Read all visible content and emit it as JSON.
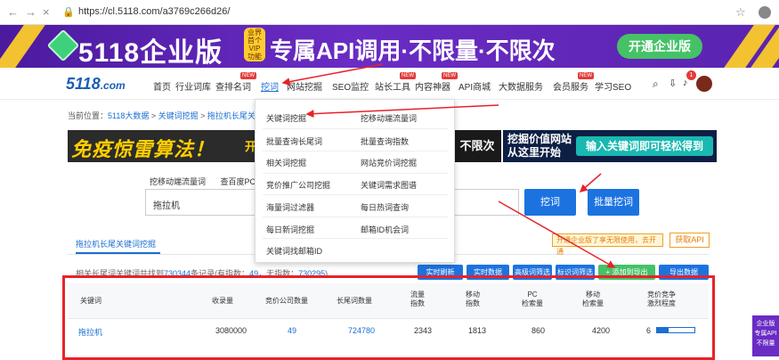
{
  "browser": {
    "url": "https://cl.5118.com/a3769c266d26/",
    "nav_back": "←",
    "nav_forward": "→",
    "reload": "×",
    "star": "☆",
    "menu": "⋮"
  },
  "banner": {
    "brand": "5118企业版",
    "slogan": "专属API调用·不限量·不限次",
    "vip_badge": "业界首个VIP功能",
    "cta": "开通企业版"
  },
  "header": {
    "logo": "5118",
    "logo_suffix": ".com",
    "nav": [
      "首页",
      "行业词库",
      "查排名词",
      "挖词",
      "网站挖掘",
      "SEO监控",
      "站长工具",
      "内容神器",
      "API商城",
      "大数据服务",
      "会员服务",
      "学习SEO"
    ],
    "new_badge": "NEW",
    "notification_count": "1"
  },
  "breadcrumb": {
    "prefix": "当前位置：",
    "items": [
      "5118大数据",
      "关键词挖掘",
      "拖拉机长尾关键"
    ],
    "sep": " > "
  },
  "ads": {
    "left": "免疫惊雷算法！",
    "mid_left": "开",
    "mid": "不限次",
    "right_title": "挖掘价值网站\n从这里开始",
    "right_cta": "输入关键词即可轻松得到"
  },
  "search": {
    "subtabs": [
      "挖移动端流量词",
      "查百度PC"
    ],
    "value": "拖拉机",
    "submit": "挖词",
    "batch": "批量挖词"
  },
  "dropdown": {
    "items": [
      [
        "关键词挖掘",
        "挖移动端流量词"
      ],
      [
        "批量查询长尾词",
        "批量查询指数"
      ],
      [
        "相关词挖掘",
        "网站竞价词挖掘"
      ],
      [
        "竞价推广公司挖掘",
        "关键词需求图谱"
      ],
      [
        "海量词过滤器",
        "每日热词查询"
      ],
      [
        "每日新词挖掘",
        "邮箱ID机会词"
      ],
      [
        "关键词找邮箱ID",
        ""
      ]
    ]
  },
  "results": {
    "tab": "拖拉机长尾关键词挖掘",
    "tip": "开通企业版了享无限使用，去开通",
    "get_api": "获取API",
    "summary_prefix": "相关长尾词关键词共找到",
    "total": "730344",
    "summary_mid": "条记录(有指数：",
    "indexed": "49",
    "summary_end": "，无指数：",
    "unindexed": "730295",
    "summary_close": ")"
  },
  "toolbar": [
    "实时刷新",
    "实时数据",
    "高级词筛选",
    "标识词筛选",
    "+ 添加到导出",
    "导出数据"
  ],
  "table": {
    "headers": [
      {
        "label": "关键词"
      },
      {
        "label": "收录量"
      },
      {
        "label": "竞价公司数量"
      },
      {
        "label": "长尾词数量"
      },
      {
        "label": "流量\n指数"
      },
      {
        "label": "移动\n指数"
      },
      {
        "label": "PC\n检索量"
      },
      {
        "label": "移动\n检索量"
      },
      {
        "label": "竞价竞争\n激烈程度"
      }
    ],
    "rows": [
      [
        "拖拉机",
        "3080000",
        "49",
        "724780",
        "2343",
        "1813",
        "860",
        "4200",
        "6"
      ]
    ],
    "competition_level": 0.3
  },
  "float_panel": {
    "text": "企业版\n专属API\n不限量"
  },
  "colors": {
    "brand_purple": "#5a23b0",
    "primary": "#1c73e0",
    "highlight_red": "#e8222a",
    "green": "#45c266"
  }
}
